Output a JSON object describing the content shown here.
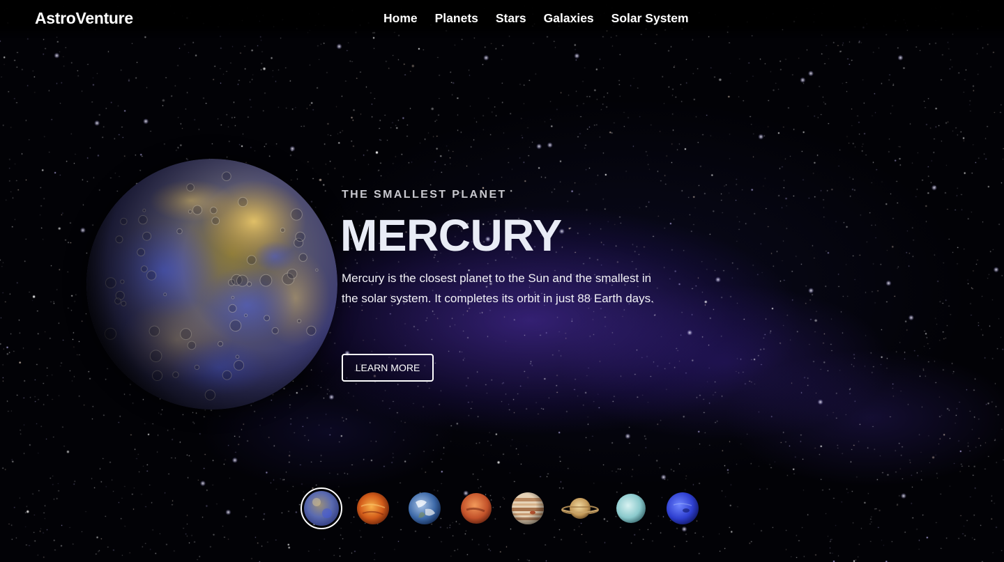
{
  "brand": "AstroVenture",
  "nav": {
    "items": [
      "Home",
      "Planets",
      "Stars",
      "Galaxies",
      "Solar System"
    ]
  },
  "hero": {
    "eyebrow": "THE SMALLEST PLANET",
    "title": "MERCURY",
    "description": "Mercury is the closest planet to the Sun and the smallest in the solar system. It completes its orbit in just 88 Earth days.",
    "cta_label": "LEARN MORE"
  },
  "planet_selector": {
    "selected": "mercury",
    "items": [
      "mercury",
      "venus",
      "earth",
      "mars",
      "jupiter",
      "saturn",
      "uranus",
      "neptune"
    ]
  },
  "colors": {
    "background": "#000000",
    "text": "#ffffff",
    "nebula": "#5834be"
  }
}
